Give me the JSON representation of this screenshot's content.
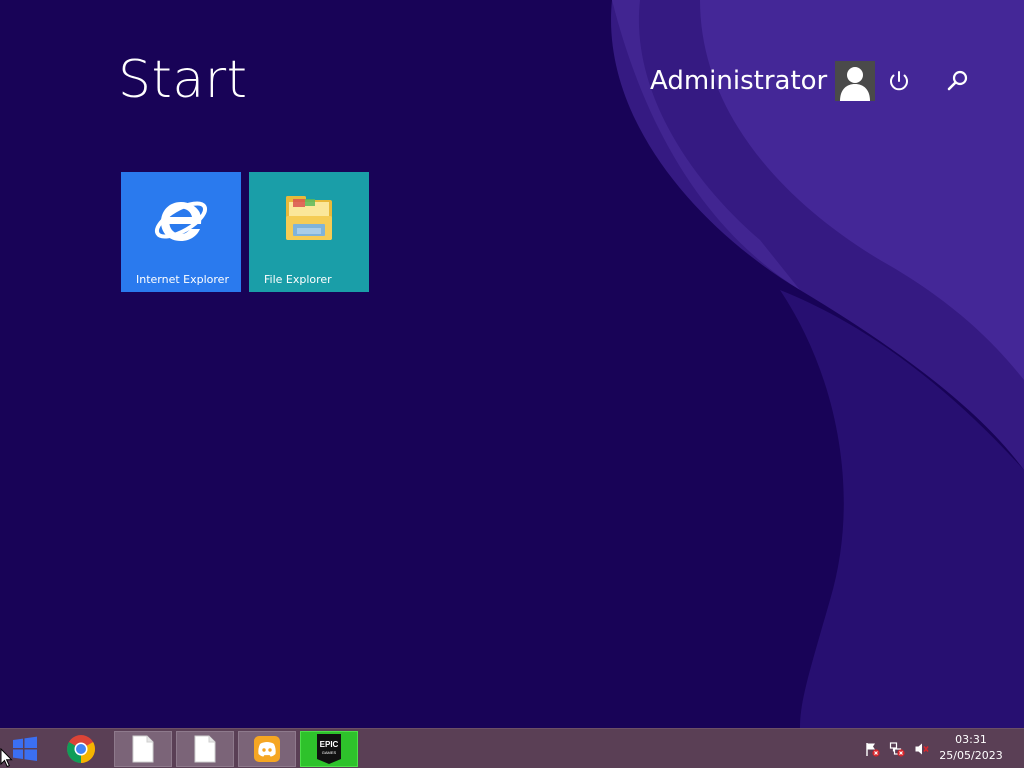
{
  "start": {
    "title": "Start",
    "user_name": "Administrator"
  },
  "icons": {
    "avatar": "user-avatar-icon",
    "power": "power-icon",
    "search": "search-icon"
  },
  "tiles": [
    {
      "label": "Internet Explorer",
      "icon": "internet-explorer-icon",
      "color": "#2a7aee"
    },
    {
      "label": "File Explorer",
      "icon": "folder-icon",
      "color": "#1a9ea8"
    }
  ],
  "taskbar": {
    "items": [
      {
        "name": "chrome",
        "icon": "chrome-icon"
      },
      {
        "name": "document-1",
        "icon": "document-icon"
      },
      {
        "name": "document-2",
        "icon": "document-icon"
      },
      {
        "name": "discord",
        "icon": "discord-icon"
      },
      {
        "name": "epic-games",
        "icon": "epic-games-icon",
        "logo_text": "EPIC GAMES"
      }
    ],
    "tray": [
      "action-center-flag-icon",
      "network-disconnected-icon",
      "volume-muted-icon"
    ],
    "clock": {
      "time": "03:31",
      "date": "25/05/2023"
    }
  },
  "colors": {
    "background": "#180357",
    "taskbar": "#5a3f55",
    "accent": "#2ec22b"
  }
}
